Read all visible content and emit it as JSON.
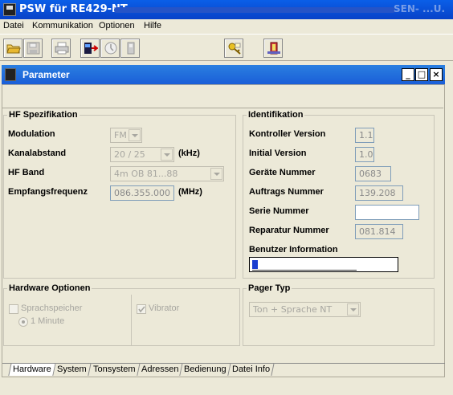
{
  "window": {
    "title": "PSW für RE429-NT -",
    "title_tail": "SEN- ...U."
  },
  "menu": [
    "Datei",
    "Kommunikation",
    "Optionen",
    "Hilfe"
  ],
  "toolbar": {
    "icons": [
      "open-folder-icon",
      "save-icon",
      "print-icon",
      "connect-icon",
      "clock-icon",
      "device-icon",
      "key-icon",
      "pager-icon"
    ]
  },
  "inner_window": {
    "title": "Parameter",
    "buttons": [
      "_",
      "□",
      "×"
    ]
  },
  "hf": {
    "legend": "HF Spezifikation",
    "modulation_label": "Modulation",
    "modulation_value": "FM",
    "kanal_label": "Kanalabstand",
    "kanal_value": "20 / 25",
    "kanal_unit": "(kHz)",
    "band_label": "HF Band",
    "band_value": "4m OB  81...88",
    "freq_label": "Empfangsfrequenz",
    "freq_value": "086.355.000",
    "freq_unit": "(MHz)"
  },
  "ident": {
    "legend": "Identifikation",
    "kontroller_label": "Kontroller Version",
    "kontroller_value": "1.1",
    "initial_label": "Initial Version",
    "initial_value": "1.0",
    "geraete_label": "Geräte Nummer",
    "geraete_value": "0683",
    "auftrag_label": "Auftrags Nummer",
    "auftrag_value": "139.208",
    "serie_label": "Serie Nummer",
    "serie_value": "",
    "reparatur_label": "Reparatur Nummer",
    "reparatur_value": "081.814",
    "benutzer_label": "Benutzer Information",
    "benutzer_value": ""
  },
  "hw": {
    "legend": "Hardware Optionen",
    "sprach_label": "Sprachspeicher",
    "minute_label": "1 Minute",
    "vibrator_label": "Vibrator"
  },
  "pager": {
    "legend": "Pager Typ",
    "value": "Ton + Sprache NT"
  },
  "tabs": [
    "Hardware",
    "System",
    "Tonsystem",
    "Adressen",
    "Bedienung",
    "Datei Info"
  ]
}
